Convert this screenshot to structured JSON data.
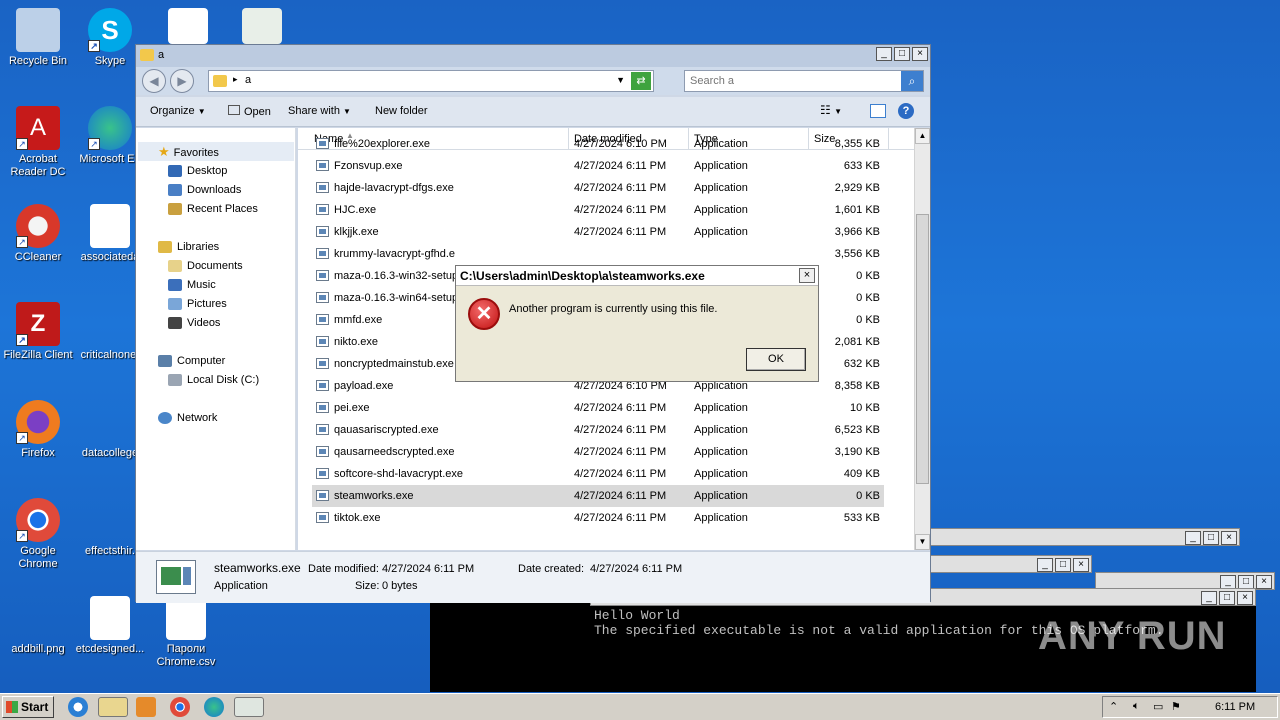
{
  "desktop": {
    "icons": [
      {
        "label": "Recycle Bin",
        "color": "#9fb7d6"
      },
      {
        "label": "Skype",
        "color": "#00a8e8"
      },
      {
        "label": "Acrobat Reader DC",
        "color": "#d21c1c"
      },
      {
        "label": "Microsoft Ed",
        "color": "#1c9fd6"
      },
      {
        "label": "CCleaner",
        "color": "#d83a2a"
      },
      {
        "label": "associateda",
        "color": "#ffffff"
      },
      {
        "label": "FileZilla Client",
        "color": "#bf1a1a"
      },
      {
        "label": "criticalnone.",
        "color": "#1d75d8"
      },
      {
        "label": "Firefox",
        "color": "#ef7b1f"
      },
      {
        "label": "datacollege",
        "color": "#1d75d8"
      },
      {
        "label": "Google Chrome",
        "color": "#2aa04a"
      },
      {
        "label": "effectsthir.",
        "color": "#1d75d8"
      },
      {
        "label": "addbill.png",
        "color": "#1d75d8"
      },
      {
        "label": "etcdesigned...",
        "color": "#ffffff"
      },
      {
        "label": "Пароли Chrome.csv",
        "color": "#ffffff"
      }
    ]
  },
  "explorer": {
    "title": "a",
    "address": "a",
    "search_placeholder": "Search a",
    "toolbar": {
      "organize": "Organize",
      "open": "Open",
      "share_with": "Share with",
      "new_folder": "New folder"
    },
    "nav": {
      "favorites": "Favorites",
      "desktop": "Desktop",
      "downloads": "Downloads",
      "recent_places": "Recent Places",
      "libraries": "Libraries",
      "documents": "Documents",
      "music": "Music",
      "pictures": "Pictures",
      "videos": "Videos",
      "computer": "Computer",
      "local_disk": "Local Disk (C:)",
      "network": "Network"
    },
    "columns": {
      "name": "Name",
      "date": "Date modified",
      "type": "Type",
      "size": "Size"
    },
    "files": [
      {
        "name": "file%20explorer.exe",
        "date": "4/27/2024 6:10 PM",
        "type": "Application",
        "size": "8,355 KB"
      },
      {
        "name": "Fzonsvup.exe",
        "date": "4/27/2024 6:11 PM",
        "type": "Application",
        "size": "633 KB"
      },
      {
        "name": "hajde-lavacrypt-dfgs.exe",
        "date": "4/27/2024 6:11 PM",
        "type": "Application",
        "size": "2,929 KB"
      },
      {
        "name": "HJC.exe",
        "date": "4/27/2024 6:11 PM",
        "type": "Application",
        "size": "1,601 KB"
      },
      {
        "name": "klkjjk.exe",
        "date": "4/27/2024 6:11 PM",
        "type": "Application",
        "size": "3,966 KB"
      },
      {
        "name": "krummy-lavacrypt-gfhd.e",
        "date": "",
        "type": "",
        "size": "3,556 KB"
      },
      {
        "name": "maza-0.16.3-win32-setup",
        "date": "",
        "type": "",
        "size": "0 KB"
      },
      {
        "name": "maza-0.16.3-win64-setup",
        "date": "",
        "type": "",
        "size": "0 KB"
      },
      {
        "name": "mmfd.exe",
        "date": "",
        "type": "",
        "size": "0 KB"
      },
      {
        "name": "nikto.exe",
        "date": "",
        "type": "",
        "size": "2,081 KB"
      },
      {
        "name": "noncryptedmainstub.exe",
        "date": "",
        "type": "",
        "size": "632 KB"
      },
      {
        "name": "payload.exe",
        "date": "4/27/2024 6:10 PM",
        "type": "Application",
        "size": "8,358 KB"
      },
      {
        "name": "pei.exe",
        "date": "4/27/2024 6:11 PM",
        "type": "Application",
        "size": "10 KB"
      },
      {
        "name": "qauasariscrypted.exe",
        "date": "4/27/2024 6:11 PM",
        "type": "Application",
        "size": "6,523 KB"
      },
      {
        "name": "qausarneedscrypted.exe",
        "date": "4/27/2024 6:11 PM",
        "type": "Application",
        "size": "3,190 KB"
      },
      {
        "name": "softcore-shd-lavacrypt.exe",
        "date": "4/27/2024 6:11 PM",
        "type": "Application",
        "size": "409 KB"
      },
      {
        "name": "steamworks.exe",
        "date": "4/27/2024 6:11 PM",
        "type": "Application",
        "size": "0 KB"
      },
      {
        "name": "tiktok.exe",
        "date": "4/27/2024 6:11 PM",
        "type": "Application",
        "size": "533 KB"
      }
    ],
    "details": {
      "filename": "steamworks.exe",
      "type": "Application",
      "modified_label": "Date modified:",
      "modified": "4/27/2024 6:11 PM",
      "created_label": "Date created:",
      "created": "4/27/2024 6:11 PM",
      "size_label": "Size:",
      "size": "0 bytes"
    }
  },
  "dialog": {
    "title": "C:\\Users\\admin\\Desktop\\a\\steamworks.exe",
    "message": "Another program is currently using this file.",
    "ok": "OK",
    "close": "×"
  },
  "console": {
    "line1": "Hello World",
    "line2": "The specified executable is not a valid application for this OS platform."
  },
  "watermark": "ANY RUN",
  "taskbar": {
    "start": "Start",
    "clock": "6:11 PM"
  }
}
